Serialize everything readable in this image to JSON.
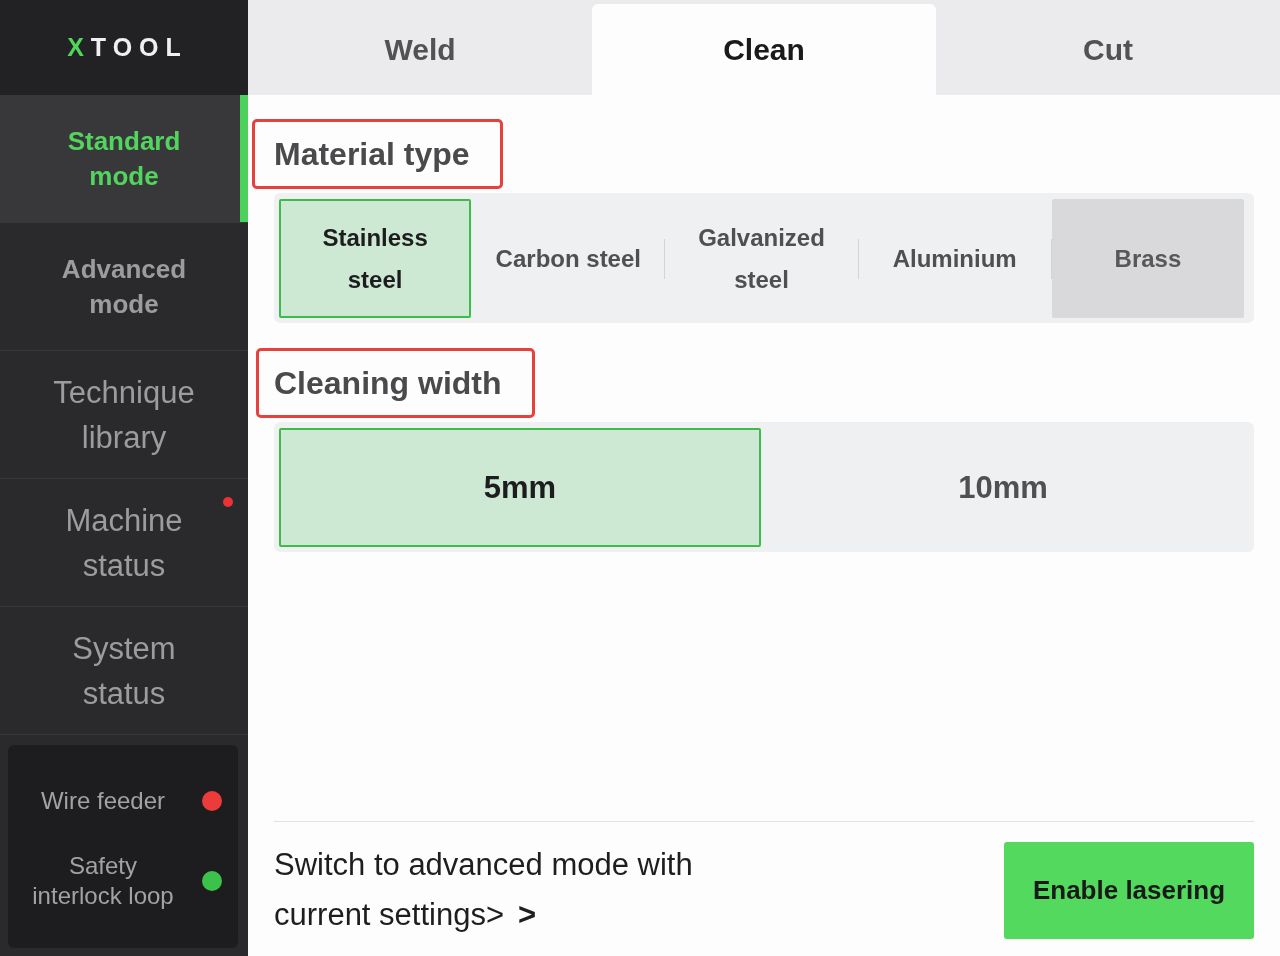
{
  "sidebar": {
    "logo": "XTOOL",
    "items": [
      {
        "label": "Standard mode",
        "kind": "mode",
        "selected": true,
        "alert": false
      },
      {
        "label": "Advanced mode",
        "kind": "mode",
        "selected": false,
        "alert": false
      },
      {
        "label": "Technique library",
        "kind": "page",
        "selected": false,
        "alert": false
      },
      {
        "label": "Machine status",
        "kind": "page",
        "selected": false,
        "alert": true
      },
      {
        "label": "System status",
        "kind": "page",
        "selected": false,
        "alert": false
      }
    ],
    "status_panel": [
      {
        "label": "Wire feeder",
        "color": "#ec3b3b"
      },
      {
        "label": "Safety interlock loop",
        "color": "#3cc24b"
      }
    ]
  },
  "tabs": [
    {
      "label": "Weld",
      "selected": false
    },
    {
      "label": "Clean",
      "selected": true
    },
    {
      "label": "Cut",
      "selected": false
    }
  ],
  "sections": [
    {
      "title": "Material type",
      "highlighted": true,
      "options": [
        {
          "label": "Stainless steel",
          "selected": true,
          "disabled": false
        },
        {
          "label": "Carbon steel",
          "selected": false,
          "disabled": false
        },
        {
          "label": "Galvanized steel",
          "selected": false,
          "disabled": false
        },
        {
          "label": "Aluminium",
          "selected": false,
          "disabled": false
        },
        {
          "label": "Brass",
          "selected": false,
          "disabled": true
        }
      ]
    },
    {
      "title": "Cleaning width",
      "highlighted": true,
      "options": [
        {
          "label": "5mm",
          "selected": true,
          "disabled": false
        },
        {
          "label": "10mm",
          "selected": false,
          "disabled": false
        }
      ]
    }
  ],
  "footer": {
    "link": "Switch to advanced mode with current settings>",
    "arrow": ">",
    "button": "Enable lasering"
  }
}
